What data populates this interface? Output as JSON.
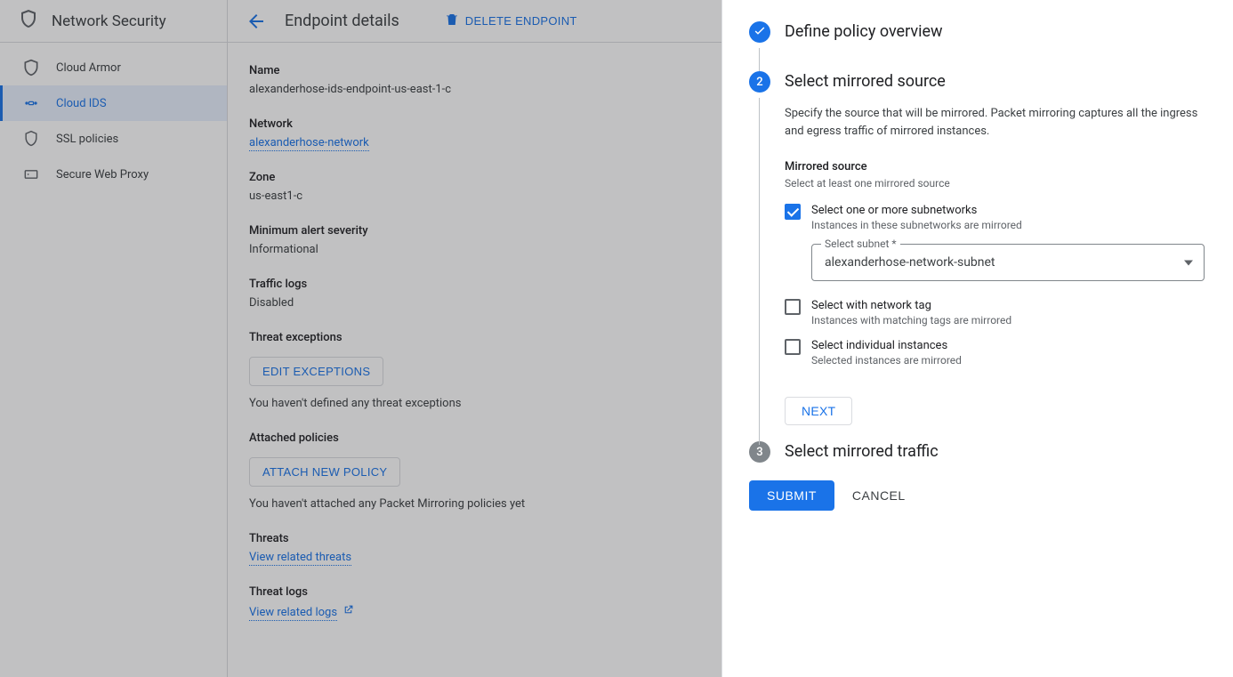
{
  "sidebar": {
    "product": "Network Security",
    "items": [
      {
        "label": "Cloud Armor"
      },
      {
        "label": "Cloud IDS"
      },
      {
        "label": "SSL policies"
      },
      {
        "label": "Secure Web Proxy"
      }
    ]
  },
  "header": {
    "title": "Endpoint details",
    "delete_label": "DELETE ENDPOINT"
  },
  "details": {
    "name_label": "Name",
    "name_value": "alexanderhose-ids-endpoint-us-east-1-c",
    "network_label": "Network",
    "network_value": "alexanderhose-network",
    "zone_label": "Zone",
    "zone_value": "us-east1-c",
    "severity_label": "Minimum alert severity",
    "severity_value": "Informational",
    "logs_label": "Traffic logs",
    "logs_value": "Disabled",
    "exceptions_label": "Threat exceptions",
    "edit_exceptions_btn": "EDIT EXCEPTIONS",
    "exceptions_note": "You haven't defined any threat exceptions",
    "policies_label": "Attached policies",
    "attach_policy_btn": "ATTACH NEW POLICY",
    "policies_note": "You haven't attached any Packet Mirroring policies yet",
    "threats_label": "Threats",
    "threats_link": "View related threats",
    "threat_logs_label": "Threat logs",
    "threat_logs_link": "View related logs"
  },
  "panel": {
    "step1_title": "Define policy overview",
    "step2_title": "Select mirrored source",
    "step2_desc": "Specify the source that will be mirrored. Packet mirroring captures all the ingress and egress traffic of mirrored instances.",
    "mirrored_source_label": "Mirrored source",
    "mirrored_source_hint": "Select at least one mirrored source",
    "opt_subnet_label": "Select one or more subnetworks",
    "opt_subnet_hint": "Instances in these subnetworks are mirrored",
    "select_subnet_label": "Select subnet *",
    "select_subnet_value": "alexanderhose-network-subnet",
    "opt_tag_label": "Select with network tag",
    "opt_tag_hint": "Instances with matching tags are mirrored",
    "opt_instances_label": "Select individual instances",
    "opt_instances_hint": "Selected instances are mirrored",
    "next_label": "NEXT",
    "step3_title": "Select mirrored traffic",
    "submit_label": "SUBMIT",
    "cancel_label": "CANCEL"
  }
}
